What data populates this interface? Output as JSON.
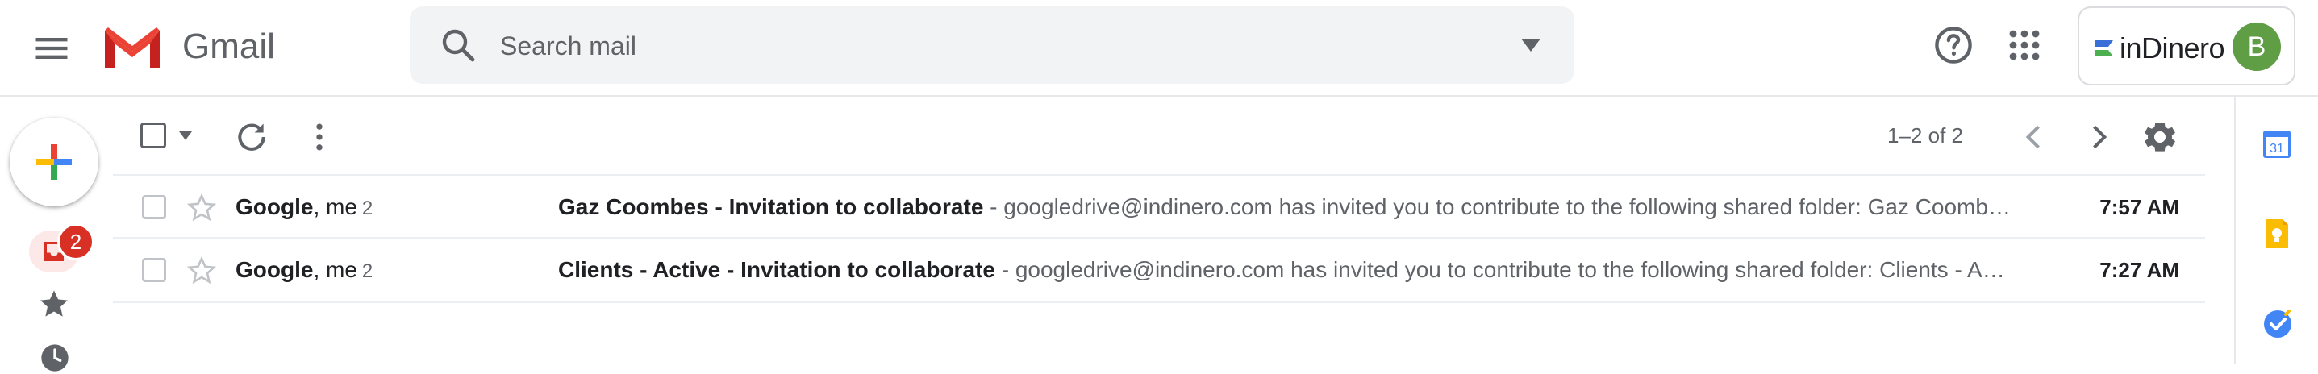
{
  "app": {
    "name": "Gmail"
  },
  "search": {
    "placeholder": "Search mail",
    "value": ""
  },
  "account": {
    "organization": "inDinero",
    "avatar_initial": "B",
    "avatar_color": "#5f9e44"
  },
  "nav": {
    "inbox_badge": "2"
  },
  "toolbar": {
    "pagination": "1–2 of 2"
  },
  "messages": [
    {
      "sender": "Google, me",
      "sender_bold": "Google",
      "sender_rest": ", me",
      "count": "2",
      "subject": "Gaz Coombes - Invitation to collaborate",
      "snippet": " - googledrive@indinero.com has invited you to contribute to the following shared folder: Gaz Coomb…",
      "time": "7:57 AM",
      "starred": false
    },
    {
      "sender": "Google, me",
      "sender_bold": "Google",
      "sender_rest": ", me",
      "count": "2",
      "subject": "Clients - Active - Invitation to collaborate",
      "snippet": " - googledrive@indinero.com has invited you to contribute to the following shared folder: Clients - A…",
      "time": "7:27 AM",
      "starred": false
    }
  ],
  "side_panel": {
    "calendar_day": "31"
  },
  "colors": {
    "accent_red": "#d93025",
    "inbox_highlight": "#fce8e6",
    "search_bg": "#f1f3f4"
  }
}
